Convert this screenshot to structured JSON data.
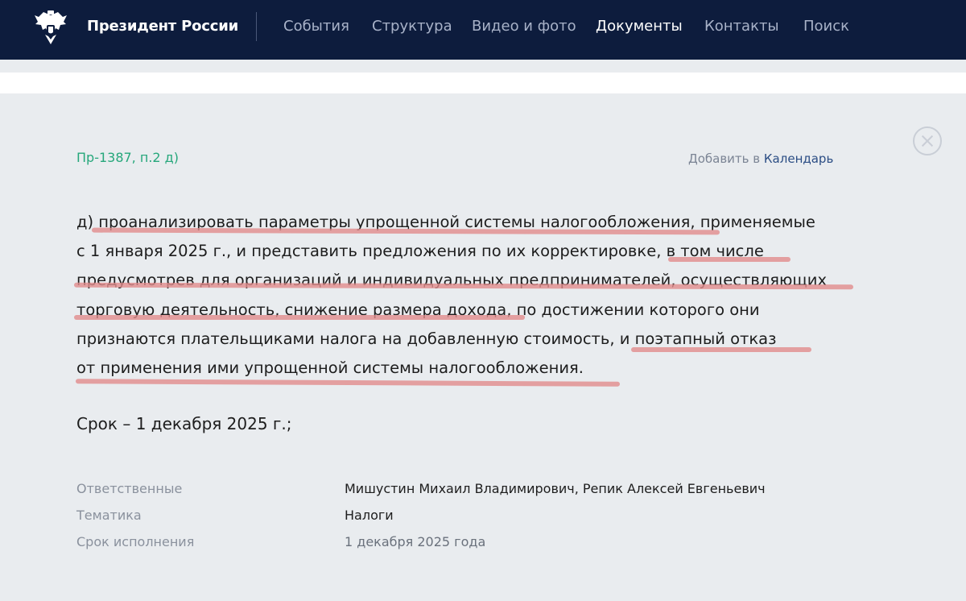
{
  "header": {
    "site_title": "Президент России",
    "nav": [
      {
        "label": "События",
        "active": false
      },
      {
        "label": "Структура",
        "active": false
      },
      {
        "label": "Видео и фото",
        "active": false
      },
      {
        "label": "Документы",
        "active": true
      },
      {
        "label": "Контакты",
        "active": false
      },
      {
        "label": "Поиск",
        "active": false
      }
    ]
  },
  "document": {
    "reference": "Пр-1387, п.2 д)",
    "add_calendar_prefix": "Добавить в",
    "add_calendar_link": "Календарь",
    "body_lines": [
      "д) проанализировать параметры упрощенной системы налогообложения, применяемые",
      "с 1 января 2025 г., и представить предложения по их корректировке, в том числе",
      "предусмотрев для организаций и индивидуальных предпринимателей, осуществляющих",
      "торговую деятельность, снижение размера дохода, по достижении которого они",
      "признаются плательщиками налога на добавленную стоимость, и поэтапный отказ",
      "от применения ими упрощенной системы налогообложения."
    ],
    "deadline": "Срок – 1 декабря 2025 г.;",
    "meta": [
      {
        "label": "Ответственные",
        "value": "Мишустин Михаил Владимирович, Репик Алексей Евгеньевич"
      },
      {
        "label": "Тематика",
        "value": "Налоги"
      },
      {
        "label": "Срок исполнения",
        "value": "1 декабря 2025 года"
      }
    ]
  },
  "colors": {
    "header_bg": "#0d1c3d",
    "reference_green": "#26a77b",
    "highlight_marker": "#e18c8c",
    "link_blue": "#2b4d84"
  },
  "icons": {
    "emblem": "double-headed-eagle-emblem",
    "close": "close-circle-icon"
  }
}
